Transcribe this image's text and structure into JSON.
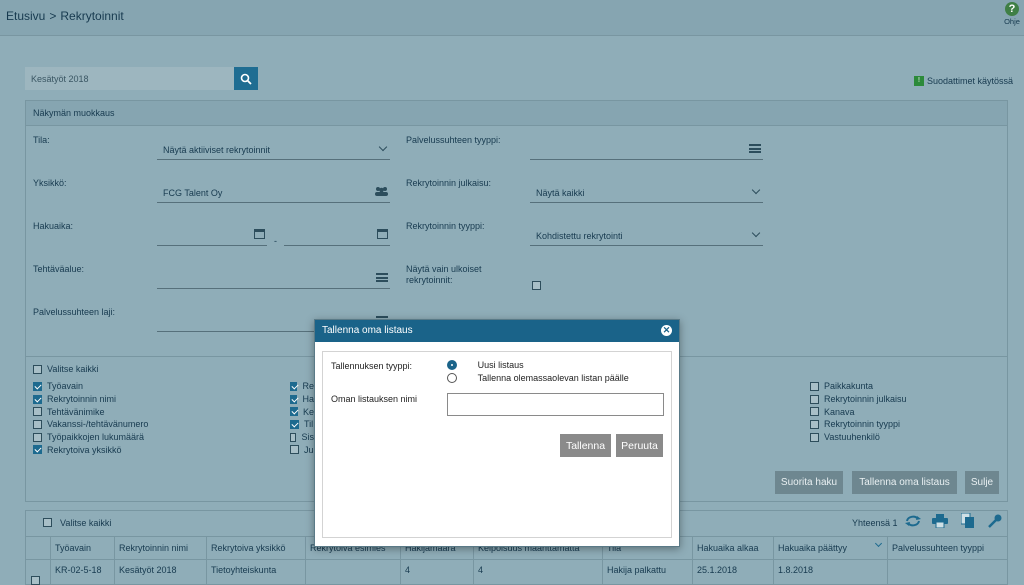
{
  "breadcrumb": {
    "home": "Etusivu",
    "separator": ">",
    "current": "Rekrytoinnit"
  },
  "help": {
    "label": "Ohje",
    "icon": "question-icon"
  },
  "search": {
    "value": "Kesätyöt 2018",
    "icon": "search-icon"
  },
  "filters_active_label": "Suodattimet käytössä",
  "view_edit": {
    "title": "Näkymän muokkaus",
    "fields": {
      "tila": {
        "label": "Tila:",
        "value": "Näytä aktiiviset rekrytoinnit"
      },
      "yksikko": {
        "label": "Yksikkö:",
        "value": "FCG Talent Oy"
      },
      "hakuaika": {
        "label": "Hakuaika:",
        "separator": "-"
      },
      "tehtavaalue": {
        "label": "Tehtäväalue:"
      },
      "palvelussuhteen_laji": {
        "label": "Palvelussuhteen laji:"
      },
      "palvelussuhteen_tyyppi": {
        "label": "Palvelussuhteen tyyppi:"
      },
      "julkaisu": {
        "label": "Rekrytoinnin julkaisu:",
        "value": "Näytä kaikki"
      },
      "rekrytoinnin_tyyppi": {
        "label": "Rekrytoinnin tyyppi:",
        "value": "Kohdistettu rekrytointi"
      },
      "ulkoiset": {
        "label_line1": "Näytä vain ulkoiset",
        "label_line2": "rekrytoinnit:"
      }
    },
    "select_all": "Valitse kaikki",
    "columns_left": [
      {
        "label": "Työavain",
        "checked": true
      },
      {
        "label": "Rekrytoinnin nimi",
        "checked": true
      },
      {
        "label": "Tehtävänimike",
        "checked": false
      },
      {
        "label": "Vakanssi-/tehtävänumero",
        "checked": false
      },
      {
        "label": "Työpaikkojen lukumäärä",
        "checked": false
      },
      {
        "label": "Rekrytoiva yksikkö",
        "checked": true
      }
    ],
    "columns_mid": [
      {
        "label": "Re",
        "checked": true
      },
      {
        "label": "Ha",
        "checked": true
      },
      {
        "label": "Ke",
        "checked": true
      },
      {
        "label": "Til",
        "checked": true
      },
      {
        "label": "Sis",
        "checked": false
      },
      {
        "label": "Ju",
        "checked": false
      }
    ],
    "columns_right": [
      {
        "label": "Paikkakunta",
        "checked": false
      },
      {
        "label": "Rekrytoinnin julkaisu",
        "checked": false
      },
      {
        "label": "Kanava",
        "checked": false
      },
      {
        "label": "Rekrytoinnin tyyppi",
        "checked": false
      },
      {
        "label": "Vastuuhenkilö",
        "checked": false
      }
    ],
    "buttons": {
      "search": "Suorita haku",
      "save_list": "Tallenna oma listaus",
      "close": "Sulje"
    }
  },
  "table": {
    "select_all": "Valitse kaikki",
    "total": "Yhteensä 1",
    "headers": [
      "Työavain",
      "Rekrytoinnin nimi",
      "Rekrytoiva yksikkö",
      "Rekrytoiva esimies",
      "Hakijamäärä",
      "Kelpoisuus määrittämättä",
      "Tila",
      "Hakuaika alkaa",
      "Hakuaika päättyy",
      "Palvelussuhteen tyyppi"
    ],
    "rows": [
      [
        "KR-02-5-18",
        "Kesätyöt 2018",
        "Tietoyhteiskunta",
        "",
        "4",
        "4",
        "Hakija palkattu",
        "25.1.2018",
        "1.8.2018",
        ""
      ]
    ]
  },
  "modal": {
    "title": "Tallenna oma listaus",
    "save_type_label": "Tallennuksen tyyppi:",
    "option_new": "Uusi listaus",
    "option_overwrite": "Tallenna olemassaolevan listan päälle",
    "selected_option": "new",
    "name_label": "Oman listauksen nimi",
    "name_value": "",
    "save_button": "Tallenna",
    "cancel_button": "Peruuta"
  }
}
